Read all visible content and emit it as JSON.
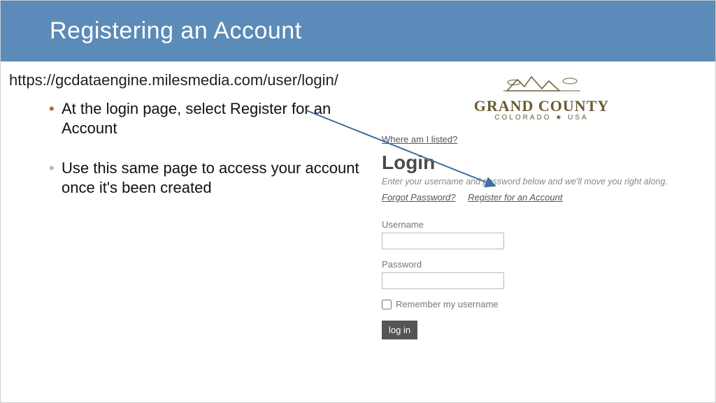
{
  "header": {
    "title": "Registering an Account"
  },
  "left": {
    "url": "https://gcdataengine.milesmedia.com/user/login/",
    "bullets": [
      "At the login page, select Register for an Account",
      "Use this same page to access your account once it's been created"
    ]
  },
  "logo": {
    "name": "GRAND COUNTY",
    "sub": "COLORADO ★ USA"
  },
  "login": {
    "where_link": "Where am I listed?",
    "title": "Login",
    "desc": "Enter your username and password below and we'll move you right along.",
    "forgot_link": "Forgot Password?",
    "register_link": "Register for an Account",
    "username_label": "Username",
    "password_label": "Password",
    "remember_label": "Remember my username",
    "login_button": "log in"
  }
}
